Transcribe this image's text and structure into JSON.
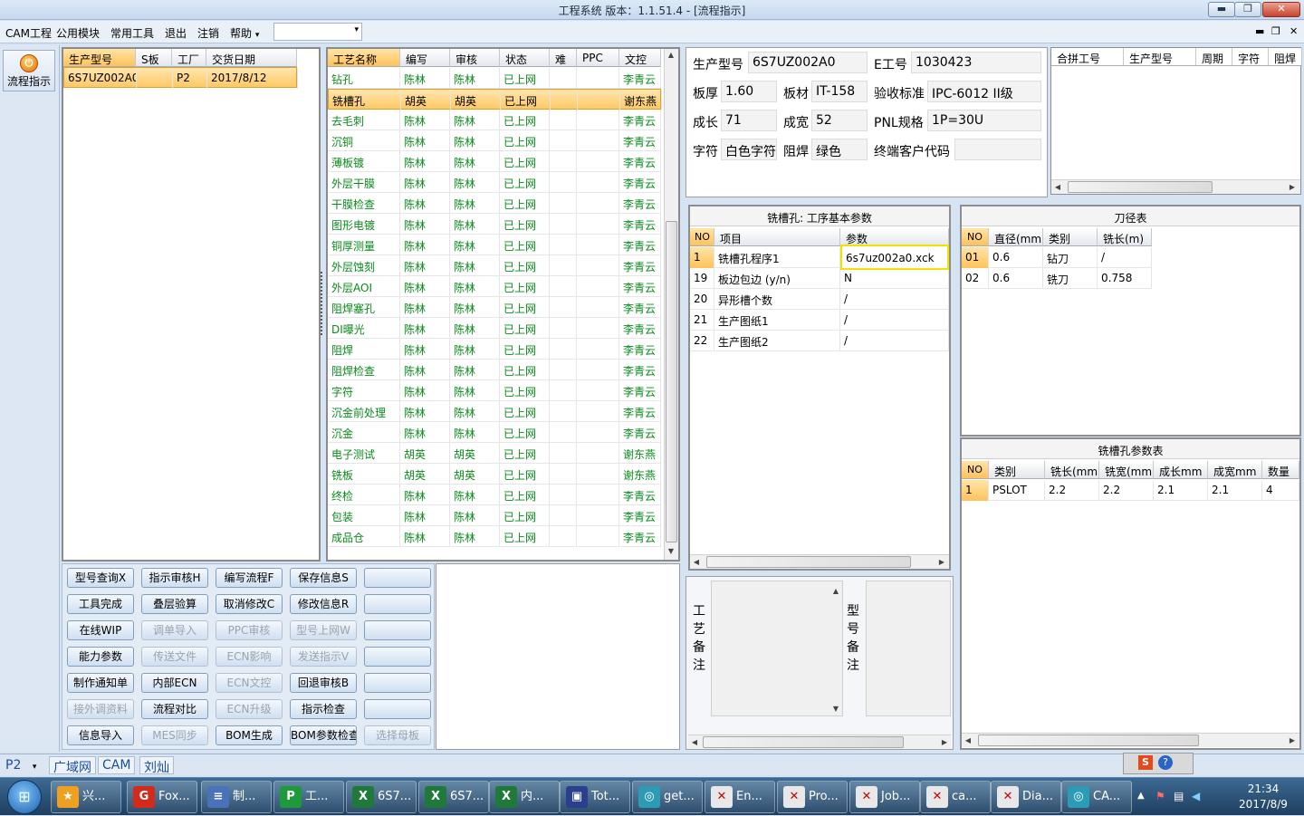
{
  "window": {
    "title": "工程系统 版本：1.1.51.4 - [流程指示]",
    "min_glyph": "▬",
    "restore_glyph": "❐",
    "close_glyph": "✕"
  },
  "menu": {
    "items": [
      "CAM工程",
      "公用模块",
      "常用工具",
      "退出",
      "注销",
      "帮助"
    ],
    "help_arrow": "▾",
    "combo_value": "",
    "combo_arrow": "▾",
    "mdi_min": "▬",
    "mdi_restore": "❐",
    "mdi_close": "✕"
  },
  "sidebar": {
    "flow_button_label": "流程指示",
    "flow_icon": "power-icon"
  },
  "order_grid": {
    "columns": [
      "生产型号",
      "S板",
      "工厂",
      "交货日期"
    ],
    "rows": [
      [
        "6S7UZ002A0",
        "",
        "P2",
        "2017/8/12"
      ]
    ]
  },
  "process_grid": {
    "columns": [
      "工艺名称",
      "编写",
      "审核",
      "状态",
      "难",
      "PPC",
      "文控"
    ],
    "selected_row": 1,
    "rows": [
      [
        "钻孔",
        "陈林",
        "陈林",
        "已上网",
        "",
        "",
        "李青云"
      ],
      [
        "铣槽孔",
        "胡英",
        "胡英",
        "已上网",
        "",
        "",
        "谢东燕"
      ],
      [
        "去毛刺",
        "陈林",
        "陈林",
        "已上网",
        "",
        "",
        "李青云"
      ],
      [
        "沉铜",
        "陈林",
        "陈林",
        "已上网",
        "",
        "",
        "李青云"
      ],
      [
        "薄板镀",
        "陈林",
        "陈林",
        "已上网",
        "",
        "",
        "李青云"
      ],
      [
        "外层干膜",
        "陈林",
        "陈林",
        "已上网",
        "",
        "",
        "李青云"
      ],
      [
        "干膜检查",
        "陈林",
        "陈林",
        "已上网",
        "",
        "",
        "李青云"
      ],
      [
        "图形电镀",
        "陈林",
        "陈林",
        "已上网",
        "",
        "",
        "李青云"
      ],
      [
        "铜厚测量",
        "陈林",
        "陈林",
        "已上网",
        "",
        "",
        "李青云"
      ],
      [
        "外层蚀刻",
        "陈林",
        "陈林",
        "已上网",
        "",
        "",
        "李青云"
      ],
      [
        "外层AOI",
        "陈林",
        "陈林",
        "已上网",
        "",
        "",
        "李青云"
      ],
      [
        "阻焊塞孔",
        "陈林",
        "陈林",
        "已上网",
        "",
        "",
        "李青云"
      ],
      [
        "DI曝光",
        "陈林",
        "陈林",
        "已上网",
        "",
        "",
        "李青云"
      ],
      [
        "阻焊",
        "陈林",
        "陈林",
        "已上网",
        "",
        "",
        "李青云"
      ],
      [
        "阻焊检查",
        "陈林",
        "陈林",
        "已上网",
        "",
        "",
        "李青云"
      ],
      [
        "字符",
        "陈林",
        "陈林",
        "已上网",
        "",
        "",
        "李青云"
      ],
      [
        "沉金前处理",
        "陈林",
        "陈林",
        "已上网",
        "",
        "",
        "李青云"
      ],
      [
        "沉金",
        "陈林",
        "陈林",
        "已上网",
        "",
        "",
        "李青云"
      ],
      [
        "电子测试",
        "胡英",
        "胡英",
        "已上网",
        "",
        "",
        "谢东燕"
      ],
      [
        "铣板",
        "胡英",
        "胡英",
        "已上网",
        "",
        "",
        "谢东燕"
      ],
      [
        "终检",
        "陈林",
        "陈林",
        "已上网",
        "",
        "",
        "李青云"
      ],
      [
        "包装",
        "陈林",
        "陈林",
        "已上网",
        "",
        "",
        "李青云"
      ],
      [
        "成品仓",
        "陈林",
        "陈林",
        "已上网",
        "",
        "",
        "李青云"
      ]
    ]
  },
  "action_buttons": [
    {
      "label": "型号查询X",
      "enabled": true
    },
    {
      "label": "指示审核H",
      "enabled": true
    },
    {
      "label": "编写流程F",
      "enabled": true
    },
    {
      "label": "保存信息S",
      "enabled": true
    },
    {
      "label": "",
      "enabled": true
    },
    {
      "label": "工具完成",
      "enabled": true
    },
    {
      "label": "叠层验算",
      "enabled": true
    },
    {
      "label": "取消修改C",
      "enabled": true
    },
    {
      "label": "修改信息R",
      "enabled": true
    },
    {
      "label": "",
      "enabled": true
    },
    {
      "label": "在线WIP",
      "enabled": true
    },
    {
      "label": "调单导入",
      "enabled": false
    },
    {
      "label": "PPC审核",
      "enabled": false
    },
    {
      "label": "型号上网W",
      "enabled": false
    },
    {
      "label": "",
      "enabled": true
    },
    {
      "label": "能力参数",
      "enabled": true
    },
    {
      "label": "传送文件",
      "enabled": false
    },
    {
      "label": "ECN影响",
      "enabled": false
    },
    {
      "label": "发送指示V",
      "enabled": false
    },
    {
      "label": "",
      "enabled": true
    },
    {
      "label": "制作通知单",
      "enabled": true
    },
    {
      "label": "内部ECN",
      "enabled": true
    },
    {
      "label": "ECN文控",
      "enabled": false
    },
    {
      "label": "回退审核B",
      "enabled": true
    },
    {
      "label": "",
      "enabled": true
    },
    {
      "label": "接外调资料",
      "enabled": false
    },
    {
      "label": "流程对比",
      "enabled": true
    },
    {
      "label": "ECN升级",
      "enabled": false
    },
    {
      "label": "指示检查",
      "enabled": true
    },
    {
      "label": "",
      "enabled": true
    },
    {
      "label": "信息导入",
      "enabled": true
    },
    {
      "label": "MES同步",
      "enabled": false
    },
    {
      "label": "BOM生成",
      "enabled": true
    },
    {
      "label": "BOM参数检查",
      "enabled": true
    },
    {
      "label": "选择母板",
      "enabled": false
    }
  ],
  "info": {
    "model_label": "生产型号",
    "model_value": "6S7UZ002A0",
    "e_label": "E工号",
    "e_value": "1030423",
    "thickness_label": "板厚",
    "thickness_value": "1.60",
    "material_label": "板材",
    "material_value": "IT-158",
    "standard_label": "验收标准",
    "standard_value": "IPC-6012 II级",
    "length_label": "成长",
    "length_value": "71",
    "width_label": "成宽",
    "width_value": "52",
    "pnl_label": "PNL规格",
    "pnl_value": "1P=30U",
    "char_label": "字符",
    "char_value": "白色字符",
    "mask_label": "阻焊",
    "mask_value": "绿色",
    "customer_label": "终端客户代码",
    "customer_value": ""
  },
  "merge_grid": {
    "columns": [
      "合拼工号",
      "生产型号",
      "周期",
      "字符",
      "阻焊"
    ]
  },
  "params": {
    "title": "铣槽孔: 工序基本参数",
    "columns": [
      "NO",
      "项目",
      "参数"
    ],
    "rows": [
      [
        "1",
        "铣槽孔程序1",
        "6s7uz002a0.xck"
      ],
      [
        "19",
        "板边包边 (y/n)",
        "N"
      ],
      [
        "20",
        "异形槽个数",
        "/"
      ],
      [
        "21",
        "生产图纸1",
        "/"
      ],
      [
        "22",
        "生产图纸2",
        "/"
      ]
    ]
  },
  "tool_table": {
    "title": "刀径表",
    "columns": [
      "NO",
      "直径(mm)",
      "类别",
      "铣长(m)"
    ],
    "rows": [
      [
        "01",
        "0.6",
        "钻刀",
        "/"
      ],
      [
        "02",
        "0.6",
        "铣刀",
        "0.758"
      ]
    ]
  },
  "slot_table": {
    "title": "铣槽孔参数表",
    "columns": [
      "NO",
      "类别",
      "铣长(mm)",
      "铣宽(mm)",
      "成长mm",
      "成宽mm",
      "数量"
    ],
    "rows": [
      [
        "1",
        "PSLOT",
        "2.2",
        "2.2",
        "2.1",
        "2.1",
        "4"
      ]
    ]
  },
  "notes": {
    "process_label": "工艺备注",
    "model_label": "型号备注"
  },
  "status": {
    "factory": "P2",
    "factory_arrow": "▾",
    "tabs": [
      "广域网",
      "CAM",
      "刘灿"
    ]
  },
  "taskbar": {
    "start_glyph": "⊞",
    "items": [
      {
        "label": "兴...",
        "icon": "star-app-icon",
        "color": "#f0a020"
      },
      {
        "label": "Fox...",
        "icon": "foxmail-icon",
        "color": "#d22b1b"
      },
      {
        "label": "制...",
        "icon": "document-icon",
        "color": "#4a72b8"
      },
      {
        "label": "工...",
        "icon": "p-app-icon",
        "color": "#1d9a3a"
      },
      {
        "label": "6S7...",
        "icon": "excel-icon",
        "color": "#1f7a3a"
      },
      {
        "label": "6S7...",
        "icon": "excel-icon",
        "color": "#1f7a3a"
      },
      {
        "label": "内...",
        "icon": "excel-icon",
        "color": "#1f7a3a"
      },
      {
        "label": "Tot...",
        "icon": "save-disk-icon",
        "color": "#2b3f8c"
      },
      {
        "label": "get...",
        "icon": "network-app-icon",
        "color": "#2c9bb5"
      },
      {
        "label": "En...",
        "icon": "x-window-icon",
        "color": "#e8e8e8"
      },
      {
        "label": "Pro...",
        "icon": "x-window-icon",
        "color": "#e8e8e8"
      },
      {
        "label": "Job...",
        "icon": "x-window-icon",
        "color": "#e8e8e8"
      },
      {
        "label": "ca...",
        "icon": "x-window-icon",
        "color": "#e8e8e8"
      },
      {
        "label": "Dia...",
        "icon": "x-window-icon",
        "color": "#e8e8e8"
      },
      {
        "label": "CA...",
        "icon": "network-app-icon",
        "color": "#2c9bb5"
      }
    ],
    "time": "21:34",
    "date": "2017/8/9"
  }
}
